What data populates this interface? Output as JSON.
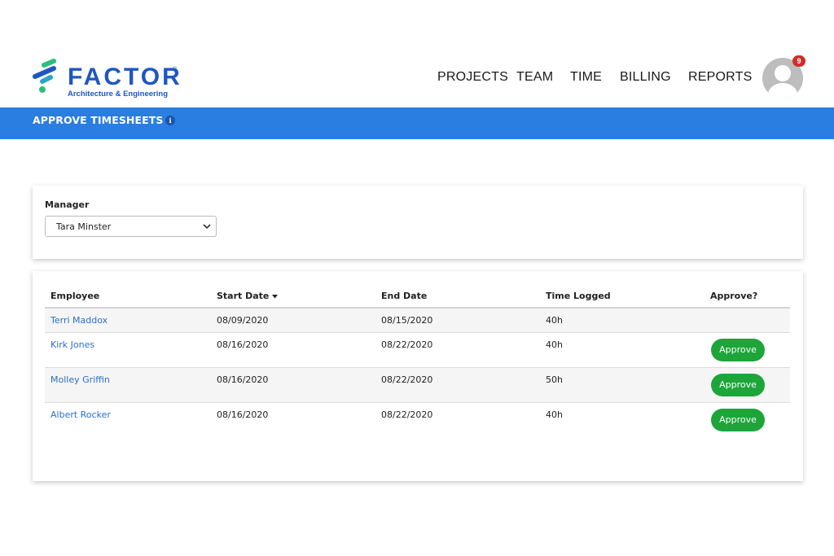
{
  "brand": {
    "name": "FACTOR",
    "registered": "®",
    "tagline": "Architecture & Engineering"
  },
  "nav": [
    {
      "label": "PROJECTS"
    },
    {
      "label": "TEAM"
    },
    {
      "label": "TIME"
    },
    {
      "label": "BILLING"
    },
    {
      "label": "REPORTS"
    }
  ],
  "user": {
    "notification_count": "9",
    "avatar_icon": "user-icon"
  },
  "page": {
    "title": "APPROVE TIMESHEETS",
    "info_icon": "i"
  },
  "manager": {
    "label": "Manager",
    "selected": "Tara Minster"
  },
  "table": {
    "columns": [
      "Employee",
      "Start Date",
      "End Date",
      "Time Logged",
      "Approve?"
    ],
    "sorted_column": "Start Date",
    "sort_direction": "descending",
    "rows": [
      {
        "employee": "Terri Maddox",
        "start": "08/09/2020",
        "end": "08/15/2020",
        "time": "40h",
        "approve": ""
      },
      {
        "employee": "Kirk Jones",
        "start": "08/16/2020",
        "end": "08/22/2020",
        "time": "40h",
        "approve": "Approve"
      },
      {
        "employee": "Molley Griffin",
        "start": "08/16/2020",
        "end": "08/22/2020",
        "time": "50h",
        "approve": "Approve"
      },
      {
        "employee": "Albert Rocker",
        "start": "08/16/2020",
        "end": "08/22/2020",
        "time": "40h",
        "approve": "Approve"
      }
    ]
  },
  "colors": {
    "brand_blue": "#1f57c2",
    "title_bar": "#2a7de1",
    "approve_green": "#1da53a",
    "link_blue": "#2a6fcf",
    "badge_red": "#c9302c",
    "logo_green": "#2bbf7a"
  }
}
